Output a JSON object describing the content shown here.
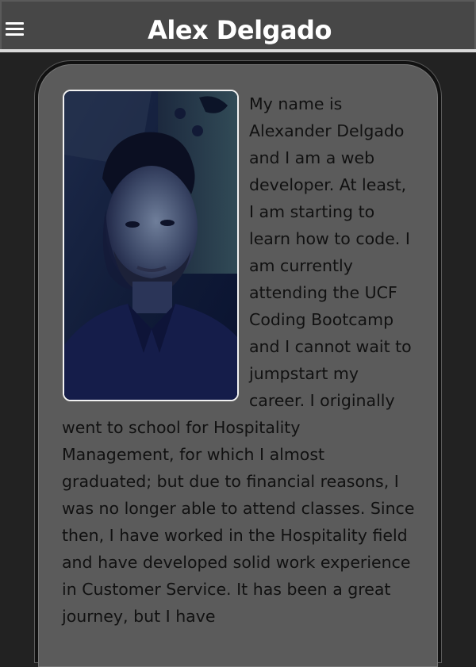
{
  "header": {
    "title": "Alex Delgado",
    "menu_icon": "hamburger-menu-icon"
  },
  "profile": {
    "photo_alt": "Alexander Delgado",
    "bio": "My name is Alexander Delgado and I am a web developer. At least, I am starting to learn how to code. I am currently attending the UCF Coding Bootcamp and I cannot wait to jumpstart my career. I originally went to school for Hospitality Management, for which I almost graduated; but due to financial reasons, I was no longer able to attend classes. Since then, I have worked in the Hospitality field and have developed solid work experience in Customer Service. It has been a great journey, but I have"
  },
  "colors": {
    "background": "#222222",
    "header": "#474747",
    "card": "#5b5b5b",
    "title_text": "#ffffff",
    "body_text": "#111111"
  }
}
